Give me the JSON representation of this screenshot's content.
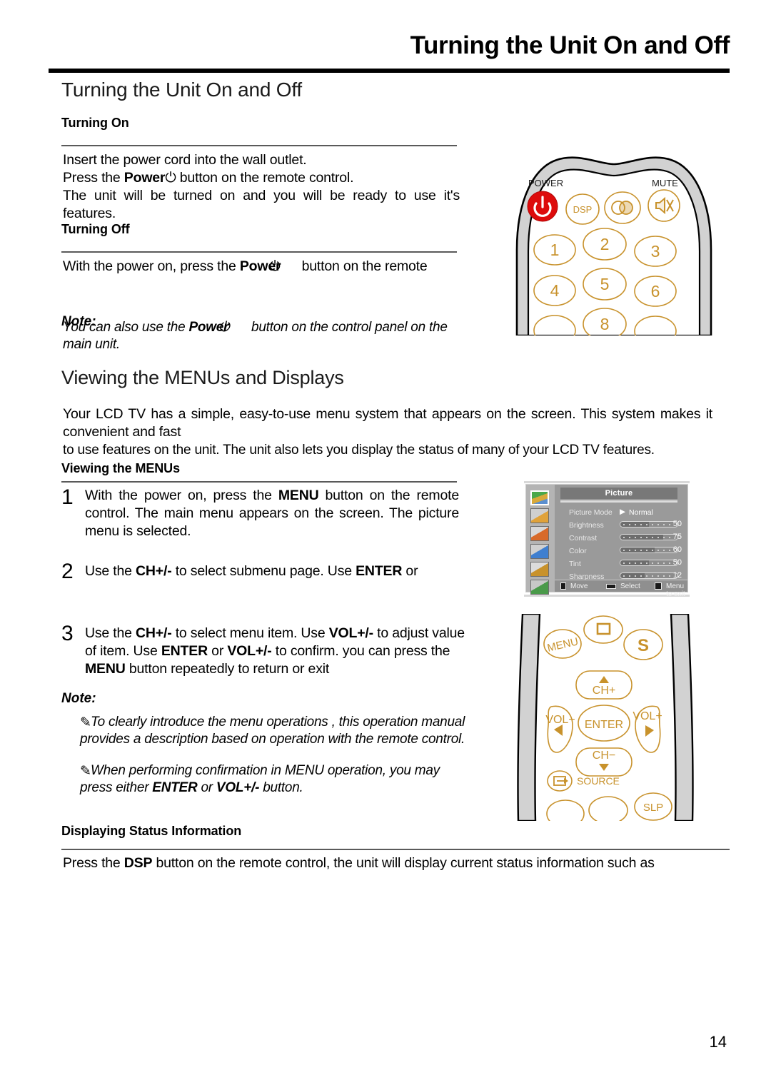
{
  "header": {
    "running_title": "Turning the Unit On and Off"
  },
  "page_number": "14",
  "sections": {
    "turning_unit": {
      "heading": "Turning the Unit On and Off",
      "turning_on": {
        "label": "Turning On",
        "line1": "Insert the power cord into the wall outlet.",
        "line2_a": "Press the ",
        "line2_b": "Power",
        "line2_icon": "⏻",
        "line2_c": " button on the remote control.",
        "line3": "The unit will be turned on and you will be ready to use it's features."
      },
      "turning_off": {
        "label": "Turning Off",
        "line1_a": "With the power on, press the ",
        "line1_b": "Power",
        "line1_icon": "⏻",
        "line1_c": "button on the remote"
      },
      "note": {
        "label": "Note:",
        "text_a": "You can also use the ",
        "text_b": "Power",
        "text_icon": "⏻",
        "text_c": " button on the control panel on the main unit."
      }
    },
    "viewing_menus": {
      "heading": "Viewing the MENUs and Displays",
      "intro_p1": "Your LCD TV has a simple, easy-to-use menu system that appears on the screen. This system makes it convenient and fast",
      "intro_p2": "to use features on the unit. The unit also lets you display the status of many of your LCD TV features.",
      "sub_label": "Viewing the MENUs",
      "steps": [
        {
          "num": "1",
          "parts": [
            {
              "t": "With the power on, press the ",
              "b": false
            },
            {
              "t": "MENU",
              "b": true
            },
            {
              "t": " button on the remote control. The main menu appears on the screen. The picture menu is selected.",
              "b": false
            }
          ]
        },
        {
          "num": "2",
          "parts": [
            {
              "t": "Use the ",
              "b": false
            },
            {
              "t": "CH+/-",
              "b": true
            },
            {
              "t": " to select submenu page. Use ",
              "b": false
            },
            {
              "t": "ENTER",
              "b": true
            },
            {
              "t": " or",
              "b": false
            }
          ]
        },
        {
          "num": "3",
          "parts": [
            {
              "t": "Use the ",
              "b": false
            },
            {
              "t": "CH+/-",
              "b": true
            },
            {
              "t": " to select menu item. Use  ",
              "b": false
            },
            {
              "t": "VOL+/-",
              "b": true
            },
            {
              "t": "  to adjust value  of item. Use ",
              "b": false
            },
            {
              "t": "ENTER",
              "b": true
            },
            {
              "t": " or ",
              "b": false
            },
            {
              "t": "VOL+/-",
              "b": true
            },
            {
              "t": " to confirm. you can press the ",
              "b": false
            },
            {
              "t": "MENU",
              "b": true
            },
            {
              "t": " button repeatedly to return or exit",
              "b": false
            }
          ]
        }
      ],
      "note": {
        "label": "Note:",
        "bullet_glyph": "✎",
        "bullets": [
          [
            {
              "t": "To clearly introduce the menu operations , this operation manual provides a description based on operation with the remote control.",
              "b": false
            }
          ],
          [
            {
              "t": "When performing confirmation in MENU operation, you may press either ",
              "b": false
            },
            {
              "t": "ENTER",
              "b": true
            },
            {
              "t": " or ",
              "b": false
            },
            {
              "t": "VOL+/-",
              "b": true
            },
            {
              "t": " button.",
              "b": false
            }
          ]
        ]
      }
    },
    "status_info": {
      "label": "Displaying Status Information",
      "parts": [
        {
          "t": "Press the ",
          "b": false
        },
        {
          "t": "DSP",
          "b": true
        },
        {
          "t": " button on the remote control, the unit will display current status information such as",
          "b": false
        }
      ]
    }
  },
  "remote_top": {
    "power_label": "POWER",
    "mute_label": "MUTE",
    "power_icon": "power-icon",
    "mute_icon": "mute-icon",
    "dsp_label": "DSP",
    "sleep_icon": "dual-circle-icon",
    "keys": [
      "1",
      "2",
      "3",
      "4",
      "5",
      "6",
      "8"
    ],
    "power_button_color": "#dd0b0b",
    "accent_color": "#c8922c"
  },
  "remote_bottom": {
    "menu_label": "MENU",
    "display_icon": "square-icon",
    "swap_label": "S",
    "ch_up_label": "CH+",
    "ch_down_label": "CH−",
    "vol_down_label": "VOL−",
    "vol_up_label": "VOL+",
    "enter_label": "ENTER",
    "source_label": "SOURCE",
    "sleep_label": "SLP",
    "accent_color": "#c8922c"
  },
  "osd": {
    "title": "Picture",
    "mode_row_label": "Picture Mode",
    "mode_value": "Normal",
    "mode_arrow": "▶",
    "rows": [
      {
        "label": "Brightness",
        "value": "50",
        "pct": 50
      },
      {
        "label": "Contrast",
        "value": "75",
        "pct": 75
      },
      {
        "label": "Color",
        "value": "60",
        "pct": 60
      },
      {
        "label": "Tint",
        "value": "50",
        "pct": 50
      },
      {
        "label": "Sharpness",
        "value": "12",
        "pct": 42
      }
    ],
    "footer": [
      {
        "key": "move-key",
        "label": "Move"
      },
      {
        "key": "select-key",
        "label": "Select"
      },
      {
        "key": "menu-key",
        "label": "Menu to exit"
      }
    ],
    "icons": [
      "picture-icon",
      "sound-icon",
      "feature-icon",
      "setup-icon",
      "lock-icon",
      "pc-icon"
    ]
  }
}
